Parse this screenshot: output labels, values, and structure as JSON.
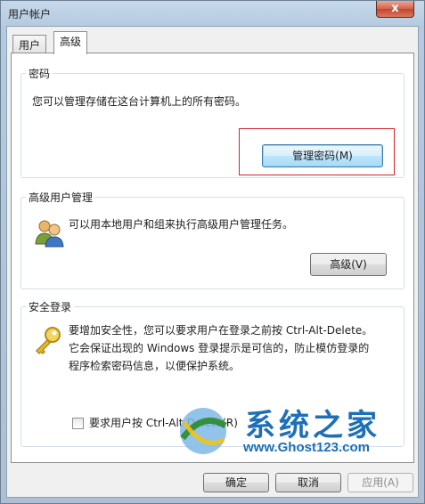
{
  "window": {
    "title": "用户帐户",
    "close_glyph": "x"
  },
  "tabs": [
    {
      "label": "用户"
    },
    {
      "label": "高级"
    }
  ],
  "passwords": {
    "title": "密码",
    "description": "您可以管理存储在这台计算机上的所有密码。",
    "manage_button": "管理密码(M)"
  },
  "advanced_users": {
    "title": "高级用户管理",
    "description": "可以用本地用户和组来执行高级用户管理任务。",
    "advanced_button": "高级(V)"
  },
  "secure_logon": {
    "title": "安全登录",
    "lines": [
      "要增加安全性，您可以要求用户在登录之前按 Ctrl-Alt-Delete。",
      "它会保证出现的 Windows 登录提示是可信的，防止模仿登录的",
      "程序检索密码信息，以便保护系统。"
    ],
    "checkbox_label": "要求用户按 Ctrl-Alt-Delete(R)",
    "checkbox_checked": false
  },
  "footer": {
    "ok": "确定",
    "cancel": "取消",
    "apply": "应用(A)"
  },
  "watermark": {
    "title": "系统之家",
    "url": "www.Ghost123.com"
  },
  "icons": {
    "close": "close-icon",
    "users": "users-icon",
    "key": "key-icon",
    "logo": "ghost-logo-icon"
  }
}
